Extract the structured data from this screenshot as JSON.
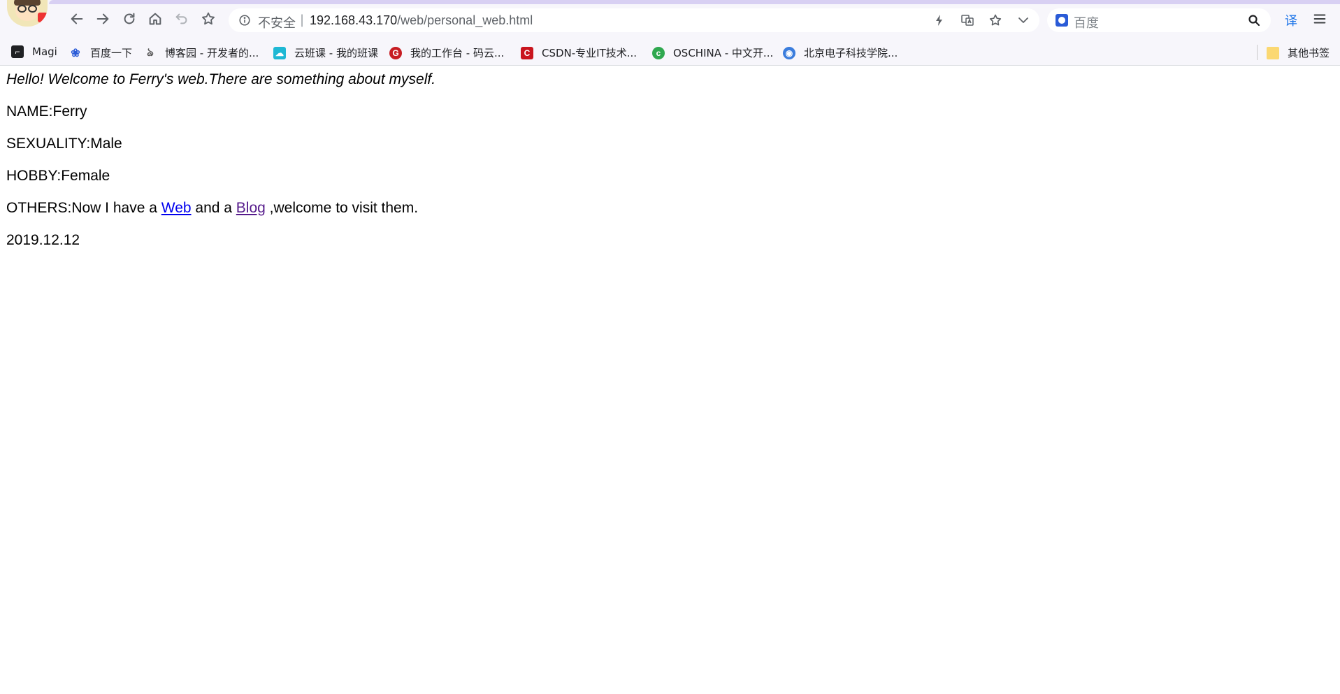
{
  "browser": {
    "security_label": "不安全",
    "url_separator": "|",
    "url_host": "192.168.43.170",
    "url_path": "/web/personal_web.html",
    "search_engine": "百度",
    "translate_label": "译"
  },
  "bookmarks": [
    {
      "label": "Magi",
      "icon": "magi-icon",
      "color": "#202124"
    },
    {
      "label": "百度一下",
      "icon": "baidu-paw-icon",
      "color": "#2a5bd7"
    },
    {
      "label": "博客园 - 开发者的...",
      "icon": "cnblogs-icon",
      "color": "#555555"
    },
    {
      "label": "云班课 - 我的班课",
      "icon": "cloud-class-icon",
      "color": "#1fb8d4"
    },
    {
      "label": "我的工作台 - 码云...",
      "icon": "gitee-icon",
      "color": "#c71d23"
    },
    {
      "label": "CSDN-专业IT技术...",
      "icon": "csdn-icon",
      "color": "#c9151e"
    },
    {
      "label": "OSCHINA - 中文开...",
      "icon": "oschina-icon",
      "color": "#2fa84f"
    },
    {
      "label": "北京电子科技学院...",
      "icon": "globe-icon",
      "color": "#3b7ddd"
    },
    {
      "label": "其他书签",
      "icon": "folder-icon",
      "color": "#fbd872"
    }
  ],
  "page": {
    "intro": "Hello! Welcome to Ferry's web.There are something about myself.",
    "name": "NAME:Ferry",
    "sexuality": "SEXUALITY:Male",
    "hobby": "HOBBY:Female",
    "others_prefix": "OTHERS:Now I have a ",
    "web_link": "Web",
    "others_middle": " and a ",
    "blog_link": "Blog",
    "others_suffix": " ,welcome to visit them.",
    "date": "2019.12.12"
  },
  "colors": {
    "link": "#0000ee",
    "visited_link": "#551a8b",
    "chrome_bg": "#f7f6fb",
    "accent": "#d8d0f3"
  }
}
